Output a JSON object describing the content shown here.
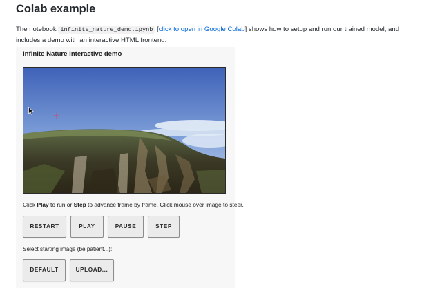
{
  "section": {
    "heading": "Colab example"
  },
  "intro": {
    "prefix": "The notebook ",
    "notebook_name": "infinite_nature_demo.ipynb",
    "bracket_open": " [",
    "link_text": "click to open in Google Colab",
    "bracket_close": "]",
    "suffix": " shows how to setup and run our trained model, and includes a demo with an interactive HTML frontend."
  },
  "demo": {
    "title": "Infinite Nature interactive demo",
    "instructions": {
      "part1": "Click ",
      "play_word": "Play",
      "part2": " to run or ",
      "step_word": "Step",
      "part3": " to advance frame by frame. Click mouse over image to steer."
    },
    "controls": {
      "restart": "RESTART",
      "play": "PLAY",
      "pause": "PAUSE",
      "step": "STEP"
    },
    "select_label": "Select starting image (be patient...):",
    "image_buttons": {
      "default": "DEFAULT",
      "upload": "UPLOAD..."
    }
  },
  "colors": {
    "link": "#0366d6",
    "crosshair": "#d6466e",
    "sky_top": "#3f62b8",
    "sky_bottom": "#b9cde9"
  }
}
